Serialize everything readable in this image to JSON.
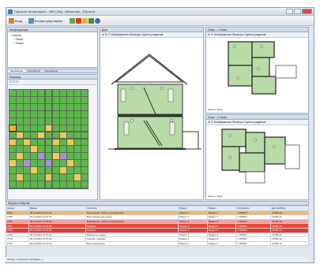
{
  "window": {
    "title": "Горизонт-Мониторинг – ВЕЛ [Упр. объектом] – [Проект]"
  },
  "toolbar": {
    "items": [
      {
        "label": "Вход",
        "icon": "user-icon"
      },
      {
        "label": "Конфигурирование",
        "icon": "settings-icon"
      }
    ]
  },
  "left_top": {
    "header": "Конфигурация",
    "tree": [
      "Объект",
      "Этаж1",
      "Этаж2"
    ]
  },
  "left_tabs": [
    "Мнемоника",
    "Устройства",
    "Расписания"
  ],
  "grid_header": "Матрица",
  "center": {
    "header": "Дом",
    "tool_label": "Изображения",
    "tool_label2": "Фильтры",
    "tool_label3": "Группа разделов"
  },
  "right_top": {
    "header": "Этаж – 1 Этаж",
    "tool_label": "Изображения",
    "tool_label2": "Фильтры",
    "tool_label3": "Группа разделов",
    "footer_a": "Объект",
    "footer_b": "Этаж"
  },
  "right_bottom": {
    "header": "Этаж – 2 Этаж",
    "tool_label": "Изображения",
    "tool_label2": "Фильтры",
    "tool_label3": "Группа разделов",
    "footer_a": "Объект",
    "footer_b": "Этаж"
  },
  "log": {
    "header": "Журнал событий",
    "columns": [
      "Номер",
      "Время",
      "Событие",
      "Объект",
      "Раздел",
      "Устройство",
      "Датчик/Вход"
    ],
    "rows": [
      {
        "style": "row-a",
        "cells": [
          "2764",
          "25.10.2012 14:07:22",
          "Восстановл. связи с устройством",
          "Объект 1",
          "Раздел 1",
          "1 УРРЕЛ",
          "СИЛЬ-12"
        ]
      },
      {
        "style": "row-w",
        "cells": [
          "2765",
          "25.10.2012 14:07:22",
          "Восстановление связи",
          "Объект 1",
          "Раздел 1",
          "1 УРРЕЛ",
          "СИЛЬ-12"
        ]
      },
      {
        "style": "row-b",
        "cells": [
          "2766",
          "25.10.2012 14:07:22",
          "Восстановл. связи с устройством",
          "Объект 1",
          "Раздел 1",
          "1 УРРЕЛ",
          "СИЛЬ-12"
        ]
      },
      {
        "style": "row-c",
        "cells": [
          "2767",
          "25.10.2012 14:07:22",
          "Тревога",
          "Объект 1",
          "Раздел 2",
          "1 УРРЕЛ",
          "СИЛЬ-12"
        ]
      },
      {
        "style": "row-d",
        "cells": [
          "2768",
          "25.10.2012 14:07:22",
          "Тревога",
          "Объект 1",
          "Раздел 2",
          "1 УРРЕЛ",
          "СИЛЬ-12"
        ]
      },
      {
        "style": "row-w",
        "cells": [
          "2769",
          "25.10.2012 14:07:22",
          "Взятие на охрану",
          "Объект 1",
          "Раздел 3",
          "1 УРРЕЛ",
          "СИЛЬ-12"
        ]
      },
      {
        "style": "row-w",
        "cells": [
          "2770",
          "25.10.2012 14:07:22",
          "Снятие с охраны",
          "Объект 1",
          "Раздел 3",
          "1 УРРЕЛ",
          "СИЛЬ-12"
        ]
      },
      {
        "style": "row-w",
        "cells": [
          "2771",
          "25.10.2012 14:07:22",
          "Восстановление",
          "Объект 1",
          "Раздел 3",
          "1 УРРЕЛ",
          "СИЛЬ-12"
        ]
      }
    ]
  },
  "status": {
    "text": "Объект_1 [Горизонт-2] Раздел_1"
  },
  "colors": {
    "green": "#5cb84a",
    "yellow": "#f3c75a",
    "purple": "#a88fd6",
    "alarm": "#e24a3c",
    "warning": "#f6b766"
  }
}
